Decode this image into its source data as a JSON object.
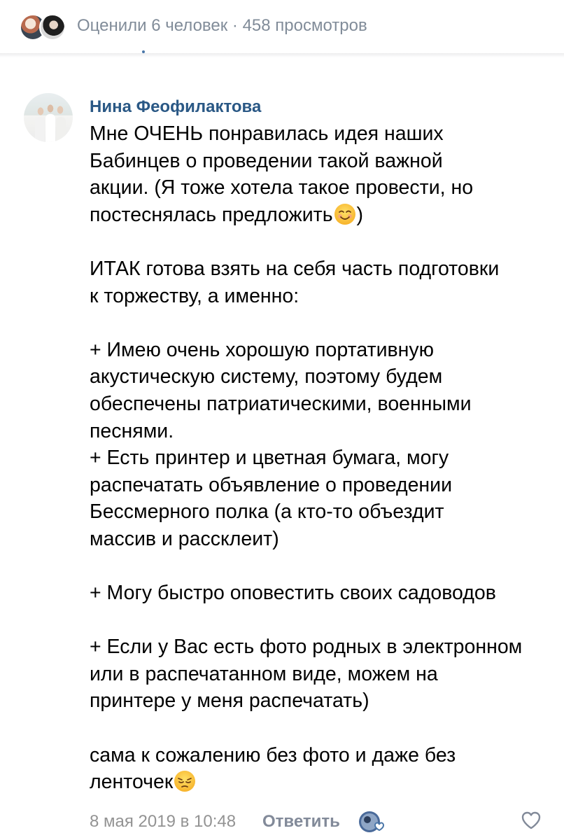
{
  "likes_bar": {
    "text": "Оценили 6 человек · 458 просмотров"
  },
  "comment": {
    "author": "Нина Феофилактова",
    "lines_1": [
      "Мне ОЧЕНЬ понравилась идея наших",
      "Бабинцев о проведении такой важной",
      "акции. (Я тоже хотела такое провести, но"
    ],
    "line_emoji_1_before": "постеснялась предложить",
    "line_emoji_1_after": ")",
    "lines_2": [
      "ИТАК готова взять на себя часть подготовки",
      "к торжеству, а именно:"
    ],
    "lines_3": [
      "+ Имею очень хорошую портативную",
      "акустическую систему, поэтому будем",
      "обеспечены патриатическими, военными",
      "песнями.",
      "+ Есть принтер и цветная бумага, могу",
      "распечатать объявление о проведении",
      "Бессмерного полка (а кто-то объездит",
      "массив и рассклеит)"
    ],
    "lines_4": [
      "+ Могу быстро оповестить своих садоводов"
    ],
    "lines_5": [
      "+ Если у Вас есть фото родных в электронном",
      "или в распечатанном виде, можем на",
      "принтере у меня распечатать)"
    ],
    "lines_6": [
      "сама к сожалению без фото и даже без"
    ],
    "line_emoji_2_before": "ленточек",
    "emoji_1": "smiling-face-emoji",
    "emoji_2": "pensive-face-emoji"
  },
  "footer": {
    "date": "8 мая 2019 в 10:48",
    "reply_label": "Ответить"
  },
  "colors": {
    "author": "#2a5885",
    "meta": "#818c99",
    "reply": "#828a99"
  }
}
